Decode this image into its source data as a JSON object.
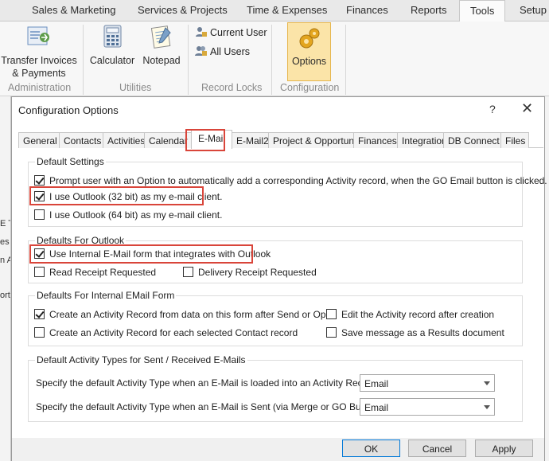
{
  "ribbon": {
    "tabs": [
      "Sales & Marketing",
      "Services & Projects",
      "Time & Expenses",
      "Finances",
      "Reports",
      "Tools",
      "Setup"
    ],
    "active_tab": "Tools",
    "buttons": {
      "transfer": "Transfer Invoices & Payments",
      "calculator": "Calculator",
      "notepad": "Notepad",
      "current_user": "Current User",
      "all_users": "All Users",
      "options": "Options"
    },
    "groups": [
      "Administration",
      "Utilities",
      "Record Locks",
      "Configuration"
    ]
  },
  "background": {
    "fragments": [
      "E Te",
      "es",
      "n A",
      "ortu"
    ]
  },
  "dialog": {
    "title": "Configuration Options",
    "help": "?",
    "close": "✕",
    "tabs": [
      "General",
      "Contacts",
      "Activities",
      "Calendar",
      "E-Mail",
      "E-Mail2",
      "Project & Opportunity",
      "Finances",
      "Integration",
      "DB Connect",
      "Files"
    ],
    "active_tab": "E-Mail",
    "default_settings": {
      "title": "Default Settings",
      "options": [
        {
          "label": "Prompt user with an Option to automatically add a corresponding Activity record, when the GO Email button is clicked.",
          "checked": true
        },
        {
          "label": "I use Outlook (32 bit) as my e-mail client.",
          "checked": true
        },
        {
          "label": "I use Outlook (64 bit) as my e-mail client.",
          "checked": false
        }
      ]
    },
    "outlook_defaults": {
      "title": "Defaults For Outlook",
      "internal_form": {
        "label": "Use Internal E-Mail form that integrates with Outlook",
        "checked": true
      },
      "read_receipt": {
        "label": "Read Receipt Requested",
        "checked": false
      },
      "delivery_receipt": {
        "label": "Delivery Receipt Requested",
        "checked": false
      }
    },
    "internal_form_defaults": {
      "title": "Defaults For Internal EMail Form",
      "create_after_send": {
        "label": "Create an Activity Record from data on this form after Send or Open",
        "checked": true
      },
      "create_per_contact": {
        "label": "Create an Activity Record for each selected Contact record",
        "checked": false
      },
      "edit_after_creation": {
        "label": "Edit the Activity record after creation",
        "checked": false
      },
      "save_as_result": {
        "label": "Save message as a Results document",
        "checked": false
      }
    },
    "activity_types": {
      "title": "Default Activity Types for Sent / Received E-Mails",
      "loaded_label": "Specify the default Activity Type when an E-Mail is loaded into an Activity Record:",
      "loaded_value": "Email",
      "sent_label": "Specify the default Activity Type when an E-Mail is Sent (via Merge or GO Button):",
      "sent_value": "Email"
    },
    "buttons": {
      "ok": "OK",
      "cancel": "Cancel",
      "apply": "Apply"
    }
  },
  "colors": {
    "highlight": "#d9453a",
    "options_button": "#fbe4a8",
    "default_button_border": "#0078d7"
  }
}
